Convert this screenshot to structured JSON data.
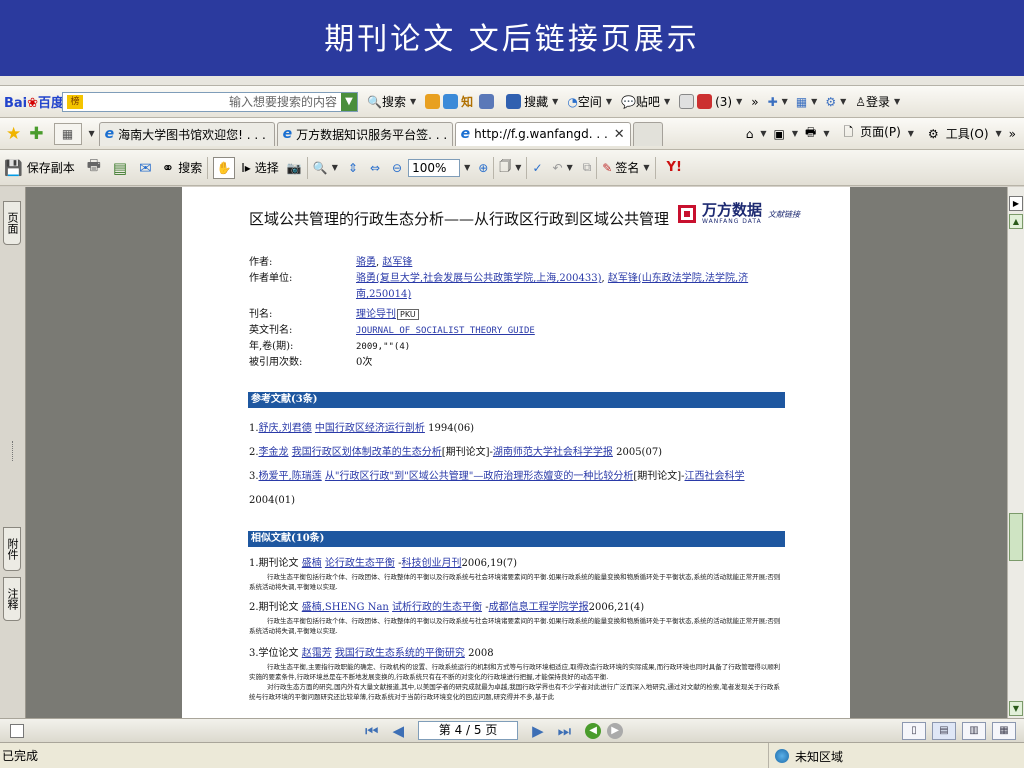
{
  "banner": {
    "title": "期刊论文 文后链接页展示"
  },
  "baidu_toolbar": {
    "logo_a": "Bai",
    "logo_b": "度",
    "logo_c": "百度",
    "box_badge": "榜",
    "search_placeholder": "输入想要搜索的内容",
    "search_btn": "搜索",
    "zhi": "知",
    "collect": "搜藏",
    "space": "空间",
    "tieba": "贴吧",
    "count": "(3)",
    "login": "登录"
  },
  "tabs_bar": {
    "tabs": [
      {
        "label": "海南大学图书馆欢迎您! . . ."
      },
      {
        "label": "万方数据知识服务平台签. . ."
      },
      {
        "label": "http://f.g.wanfangd. . ."
      }
    ],
    "page_menu": "页面(P)",
    "tools_menu": "工具(O)"
  },
  "pdf_toolbar": {
    "save_copy": "保存副本",
    "search": "搜索",
    "select": "选择",
    "zoom": "100%",
    "sign": "签名"
  },
  "side_tabs": {
    "pages": "页面",
    "attach": "附件",
    "comments": "注释"
  },
  "document": {
    "title": "区域公共管理的行政生态分析——从行政区行政到区域公共管理",
    "logo_cn": "万方数据",
    "logo_en": "WANFANG DATA",
    "logo_link": "文献链接",
    "meta": {
      "author_k": "作者:",
      "author_v1": "骆勇",
      "author_v2": "赵军锋",
      "unit_k": "作者单位:",
      "unit_v1": "骆勇(复旦大学,社会发展与公共政策学院,上海,200433)",
      "unit_v2": "赵军锋(山东政法学院,法学院,济南,250014)",
      "journal_k": "刊名:",
      "journal_v": "理论导刊",
      "pku": "PKU",
      "en_journal_k": "英文刊名:",
      "en_journal_v": "JOURNAL OF SOCIALIST THEORY GUIDE",
      "year_k": "年,卷(期):",
      "year_v": "2009,\"\"(4)",
      "cited_k": "被引用次数:",
      "cited_v": "0次"
    },
    "refs_header": "参考文献(3条)",
    "refs": [
      {
        "n": "1.",
        "a": "舒庆,刘君德",
        "t": "中国行政区经济运行剖析",
        "rest": "1994(06)"
      },
      {
        "n": "2.",
        "a": "李金龙",
        "t": "我国行政区划体制改革的生态分析",
        "mid": "[期刊论文]-",
        "j": "湖南师范大学社会科学学报",
        "rest": "2005(07)"
      },
      {
        "n": "3.",
        "a": "杨爱平,陈瑞莲",
        "t": "从\"行政区行政\"到\"区域公共管理\"—政府治理形态嬗变的一种比较分析",
        "mid": "[期刊论文]-",
        "j": "江西社会科学",
        "rest": "2004(01)"
      }
    ],
    "sim_header": "相似文献(10条)",
    "sims": [
      {
        "n": "1.期刊论文",
        "a": "盛楠",
        "t": "论行政生态平衡",
        "mid": " -",
        "j": "科技创业月刊",
        "rest": "2006,19(7)",
        "desc": "行政生态平衡包括行政个体、行政团体、行政整体的平衡以及行政系统与社会环境诸要素间的平衡.如果行政系统的能量变换和物质循环处于平衡状态,系统的活动就能正常开展;否则系统活动将失调,平衡难以实现."
      },
      {
        "n": "2.期刊论文",
        "a": "盛楠,SHENG Nan",
        "t": "试析行政的生态平衡",
        "mid": " -",
        "j": "成都信息工程学院学报",
        "rest": "2006,21(4)",
        "desc": "行政生态平衡包括行政个体、行政团体、行政整体的平衡以及行政系统与社会环境诸要素间的平衡.如果行政系统的能量变换和物质循环处于平衡状态,系统的活动就能正常开展;否则系统活动将失调,平衡难以实现."
      },
      {
        "n": "3.学位论文",
        "a": "赵霭芳",
        "t": "我国行政生态系统的平衡研究",
        "mid": " ",
        "j": "",
        "rest": "2008",
        "desc": "行政生态平衡,主要指行政职能的确定、行政机构的设置、行政系统运行的机制和方式等与行政环境相适应,取得改造行政环境的实际成果,而行政环境也同时具备了行政管理得以顺利实施的要素条件,行政环境总是在不断地发展变换的,行政系统只有在不断的对变化的行政境进行把握,才能保持良好的动态平衡.",
        "desc2": "对行政生态方面的研究,国内外有大量文献报道,其中,以美国学者的研究成就最为卓越,我国行政学界也有不少学者对此进行广泛而深入地研究,通过对文献的检索,笔者发现关于行政系统与行政环境的平衡问题研究还比较单薄,行政系统对于当前行政环境变化的回应问题,研究得并不多,基于此"
      }
    ]
  },
  "nav_bar": {
    "page": "第 4 / 5 页"
  },
  "status_bar": {
    "done": "已完成",
    "zone": "未知区域"
  },
  "colors": {
    "banner": "#2b3a9e",
    "section": "#1e57a0",
    "link": "#2a3aa8"
  }
}
